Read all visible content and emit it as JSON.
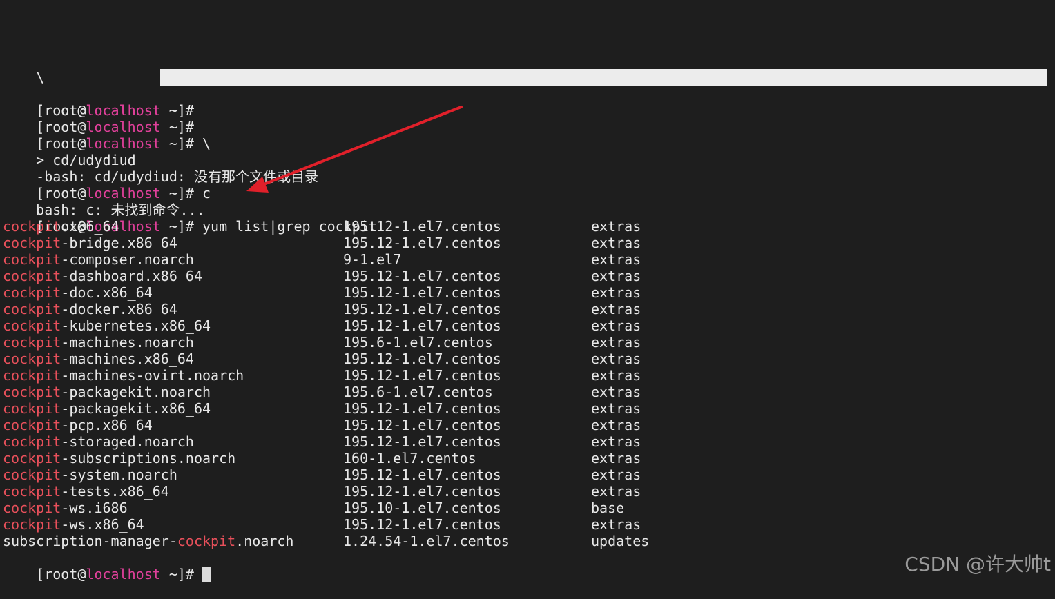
{
  "prompt": {
    "open": "[root@",
    "host": "localhost",
    "close": " ~]#"
  },
  "top_lines": {
    "backslash": "\\",
    "cmd_backslash": " \\",
    "continuation": "> cd/udydiud",
    "bash_error": "-bash: cd/udydiud: 没有那个文件或目录",
    "cmd_c": " c",
    "c_error": "bash: c: 未找到命令...",
    "cmd_yum": " yum list|grep cockpit"
  },
  "packages": [
    {
      "prefix": "",
      "match": "cockpit",
      "rest": ".x86_64",
      "version": "195.12-1.el7.centos",
      "repo": "extras"
    },
    {
      "prefix": "",
      "match": "cockpit",
      "rest": "-bridge.x86_64",
      "version": "195.12-1.el7.centos",
      "repo": "extras"
    },
    {
      "prefix": "",
      "match": "cockpit",
      "rest": "-composer.noarch",
      "version": "9-1.el7",
      "repo": "extras"
    },
    {
      "prefix": "",
      "match": "cockpit",
      "rest": "-dashboard.x86_64",
      "version": "195.12-1.el7.centos",
      "repo": "extras"
    },
    {
      "prefix": "",
      "match": "cockpit",
      "rest": "-doc.x86_64",
      "version": "195.12-1.el7.centos",
      "repo": "extras"
    },
    {
      "prefix": "",
      "match": "cockpit",
      "rest": "-docker.x86_64",
      "version": "195.12-1.el7.centos",
      "repo": "extras"
    },
    {
      "prefix": "",
      "match": "cockpit",
      "rest": "-kubernetes.x86_64",
      "version": "195.12-1.el7.centos",
      "repo": "extras"
    },
    {
      "prefix": "",
      "match": "cockpit",
      "rest": "-machines.noarch",
      "version": "195.6-1.el7.centos",
      "repo": "extras"
    },
    {
      "prefix": "",
      "match": "cockpit",
      "rest": "-machines.x86_64",
      "version": "195.12-1.el7.centos",
      "repo": "extras"
    },
    {
      "prefix": "",
      "match": "cockpit",
      "rest": "-machines-ovirt.noarch",
      "version": "195.12-1.el7.centos",
      "repo": "extras"
    },
    {
      "prefix": "",
      "match": "cockpit",
      "rest": "-packagekit.noarch",
      "version": "195.6-1.el7.centos",
      "repo": "extras"
    },
    {
      "prefix": "",
      "match": "cockpit",
      "rest": "-packagekit.x86_64",
      "version": "195.12-1.el7.centos",
      "repo": "extras"
    },
    {
      "prefix": "",
      "match": "cockpit",
      "rest": "-pcp.x86_64",
      "version": "195.12-1.el7.centos",
      "repo": "extras"
    },
    {
      "prefix": "",
      "match": "cockpit",
      "rest": "-storaged.noarch",
      "version": "195.12-1.el7.centos",
      "repo": "extras"
    },
    {
      "prefix": "",
      "match": "cockpit",
      "rest": "-subscriptions.noarch",
      "version": "160-1.el7.centos",
      "repo": "extras"
    },
    {
      "prefix": "",
      "match": "cockpit",
      "rest": "-system.noarch",
      "version": "195.12-1.el7.centos",
      "repo": "extras"
    },
    {
      "prefix": "",
      "match": "cockpit",
      "rest": "-tests.x86_64",
      "version": "195.12-1.el7.centos",
      "repo": "extras"
    },
    {
      "prefix": "",
      "match": "cockpit",
      "rest": "-ws.i686",
      "version": "195.10-1.el7.centos",
      "repo": "base"
    },
    {
      "prefix": "",
      "match": "cockpit",
      "rest": "-ws.x86_64",
      "version": "195.12-1.el7.centos",
      "repo": "extras"
    },
    {
      "prefix": "subscription-manager-",
      "match": "cockpit",
      "rest": ".noarch",
      "version": "1.24.54-1.el7.centos",
      "repo": "updates"
    }
  ],
  "watermark": "CSDN @许大帅t",
  "colors": {
    "background": "#1e1e1e",
    "text": "#e8e8e8",
    "hostname": "#e0409a",
    "grep_match": "#e8505b",
    "annotation_arrow": "#e0202a"
  },
  "icons": {
    "annotation": "arrow-annotation-icon"
  }
}
